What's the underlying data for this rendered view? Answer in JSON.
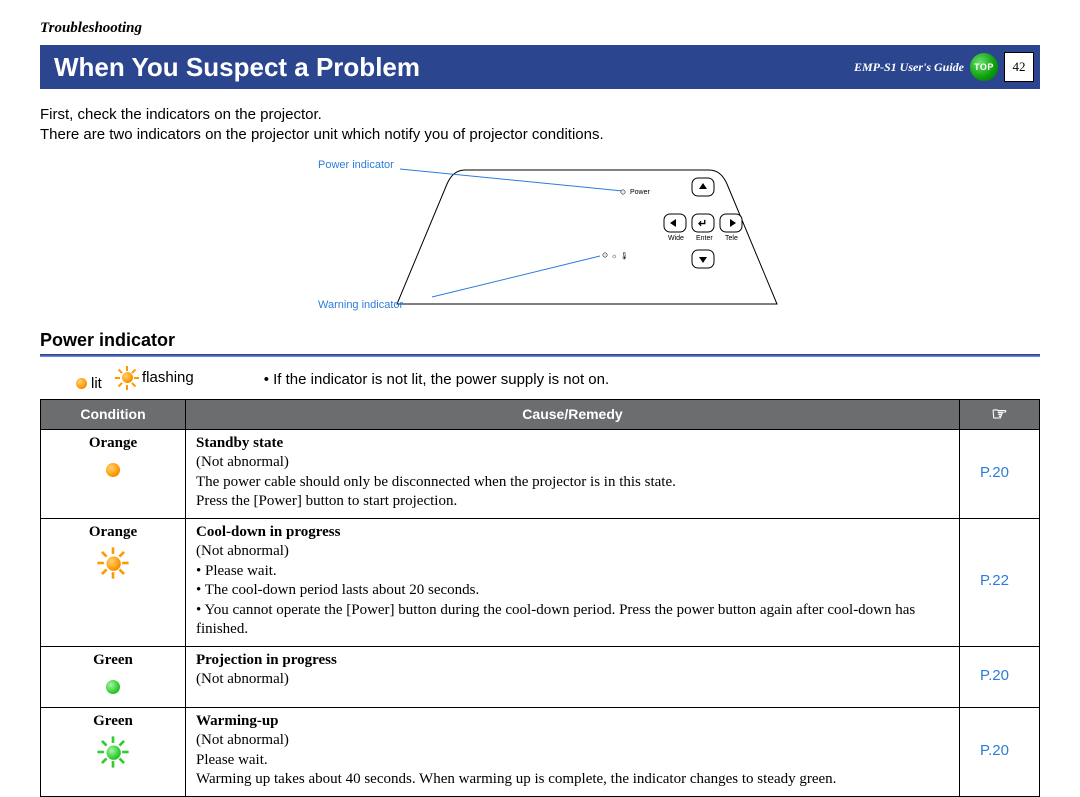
{
  "breadcrumb": "Troubleshooting",
  "title": "When You Suspect a Problem",
  "guide_label": "EMP-S1 User's Guide",
  "top_button": "TOP",
  "page_number": "42",
  "intro": {
    "line1": "First, check the indicators on the projector.",
    "line2": "There are two indicators on the projector unit which notify you of projector conditions."
  },
  "diagram": {
    "power_label": "Power indicator",
    "warning_label": "Warning indicator",
    "panel": {
      "power": "Power",
      "wide": "Wide",
      "enter": "Enter",
      "tele": "Tele"
    }
  },
  "section_heading": "Power indicator",
  "legend": {
    "lit": "lit",
    "flashing": "flashing",
    "note": "• If the indicator is not lit, the power supply is not on."
  },
  "table": {
    "headers": {
      "condition": "Condition",
      "cause": "Cause/Remedy",
      "ref": "☞"
    },
    "rows": [
      {
        "color": "Orange",
        "state": "lit",
        "title": "Standby state",
        "status": "(Not abnormal)",
        "lines": [
          "The power cable should only be disconnected when the projector is in this state.",
          "Press the [Power] button to start projection."
        ],
        "bullets": [],
        "ref": "P.20"
      },
      {
        "color": "Orange",
        "state": "flashing",
        "title": "Cool-down in progress",
        "status": "(Not abnormal)",
        "lines": [],
        "bullets": [
          "Please wait.",
          "The cool-down period lasts about 20 seconds.",
          "You cannot operate the [Power] button during the cool-down period. Press the power button again after cool-down has finished."
        ],
        "ref": "P.22"
      },
      {
        "color": "Green",
        "state": "lit",
        "title": "Projection in progress",
        "status": "(Not abnormal)",
        "lines": [],
        "bullets": [],
        "ref": "P.20"
      },
      {
        "color": "Green",
        "state": "flashing",
        "title": "Warming-up",
        "status": "(Not abnormal)",
        "lines": [
          "Please wait.",
          "Warming up takes about 40 seconds. When warming up is complete, the indicator changes to steady green."
        ],
        "bullets": [],
        "ref": "P.20"
      }
    ]
  }
}
